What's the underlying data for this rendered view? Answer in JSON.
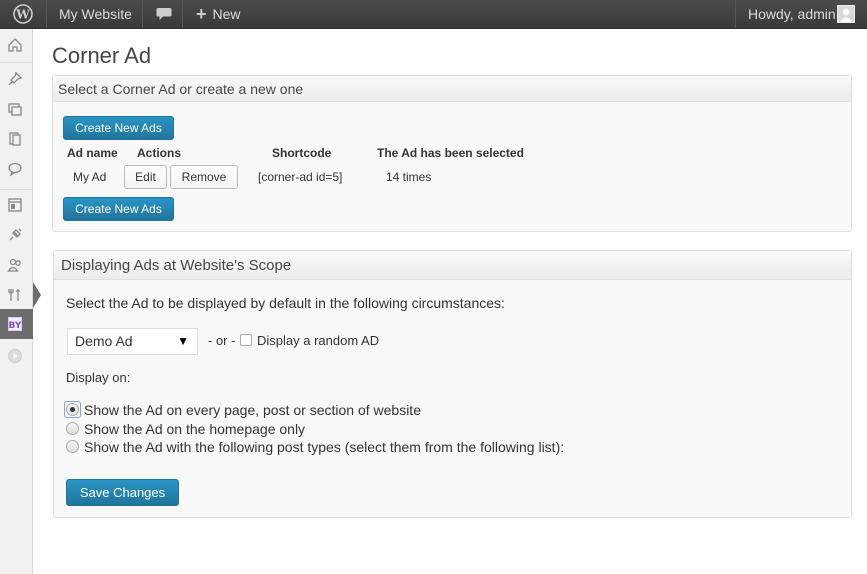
{
  "adminbar": {
    "site_name": "My Website",
    "new_label": "New",
    "howdy": "Howdy, admin",
    "icons": [
      "wordpress-icon",
      "comment-bubble-icon",
      "plus-icon",
      "avatar"
    ]
  },
  "sidebar": {
    "icons": [
      "dashboard-icon",
      "pin-icon",
      "media-icon",
      "pages-icon",
      "comments-icon",
      "appearance-icon",
      "plugins-icon",
      "users-icon",
      "tools-icon",
      "corner-ad-icon",
      "collapse-icon"
    ]
  },
  "page": {
    "title": "Corner Ad"
  },
  "box1": {
    "title": "Select a Corner Ad or create a new one",
    "create_button": "Create New Ads",
    "columns": [
      "Ad name",
      "Actions",
      "Shortcode",
      "The Ad has been selected"
    ],
    "rows": [
      {
        "name": "My Ad",
        "edit": "Edit",
        "remove": "Remove",
        "shortcode": "[corner-ad id=5]",
        "selected": "14 times"
      }
    ]
  },
  "box2": {
    "title": "Displaying Ads at Website's Scope",
    "intro": "Select the Ad to be displayed by default in the following circumstances:",
    "selected_ad": "Demo Ad",
    "or_label": "- or -",
    "random_label": "Display a random AD",
    "display_on": "Display on:",
    "options": [
      "Show the Ad on every page, post or section of website",
      "Show the Ad on the homepage only",
      "Show the Ad with the following post types (select them from the following list):"
    ],
    "selected_option": 0,
    "save_button": "Save Changes"
  },
  "colors": {
    "adminbar": "#464646",
    "primary": "#21759b",
    "current_menu": "#6d6d6d"
  }
}
